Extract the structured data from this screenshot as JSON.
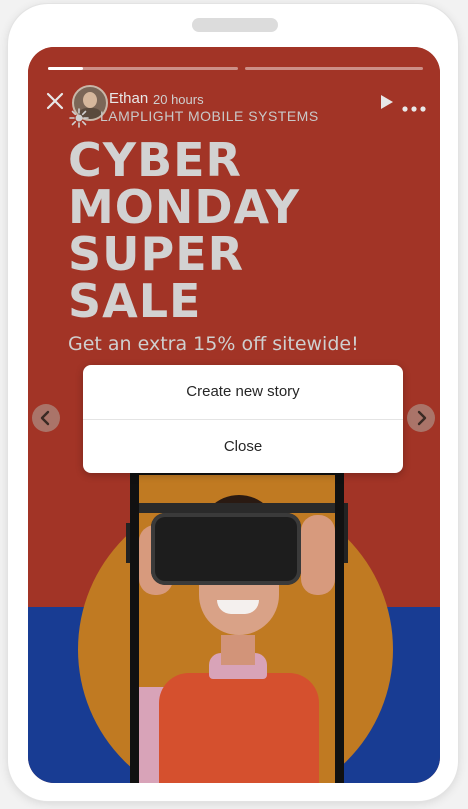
{
  "story": {
    "user_name": "Ethan",
    "time_ago": "20 hours",
    "company": "LAMPLIGHT MOBILE SYSTEMS",
    "headline_lines": [
      "CYBER",
      "MONDAY",
      "SUPER",
      "SALE"
    ],
    "subline": "Get an extra 15% off sitewide!",
    "progress_segments": 2,
    "active_segment_progress": 0.18
  },
  "menu": {
    "items": [
      "Create new story",
      "Close"
    ]
  },
  "icons": {
    "close": "close-icon",
    "play": "play-icon",
    "more": "more-icon",
    "prev": "chevron-left-icon",
    "next": "chevron-right-icon",
    "badge": "company-badge-icon"
  },
  "colors": {
    "story_red": "#a23426",
    "story_blue": "#183c93",
    "circle_orange": "#c07a22",
    "text_light": "#d2d2d2",
    "menu_bg": "#ffffff"
  }
}
